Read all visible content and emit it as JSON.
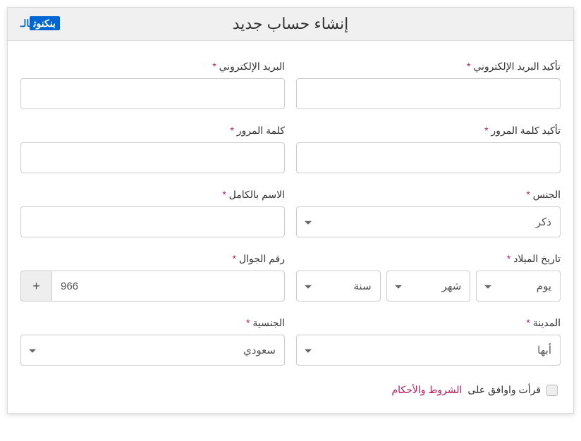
{
  "header": {
    "title": "إنشاء حساب جديد",
    "brand_prefix": "الـ",
    "brand": "بنكنوت"
  },
  "labels": {
    "email": "البريد الإلكتروني",
    "email_confirm": "تأكيد البريد الإلكتروني",
    "password": "كلمة المرور",
    "password_confirm": "تأكيد كلمة المرور",
    "fullname": "الاسم بالكامل",
    "gender": "الجنس",
    "mobile": "رقم الجوال",
    "dob": "تاريخ الميلاد",
    "nationality": "الجنسية",
    "city": "المدينة",
    "required_mark": "*"
  },
  "values": {
    "gender": "ذكر",
    "mobile_code": "966",
    "mobile_plus": "+",
    "dob_day": "يوم",
    "dob_month": "شهر",
    "dob_year": "سنة",
    "nationality": "سعودي",
    "city": "أبها"
  },
  "terms": {
    "prefix": "قرأت واوافق على",
    "link": "الشروط والأحكام"
  }
}
